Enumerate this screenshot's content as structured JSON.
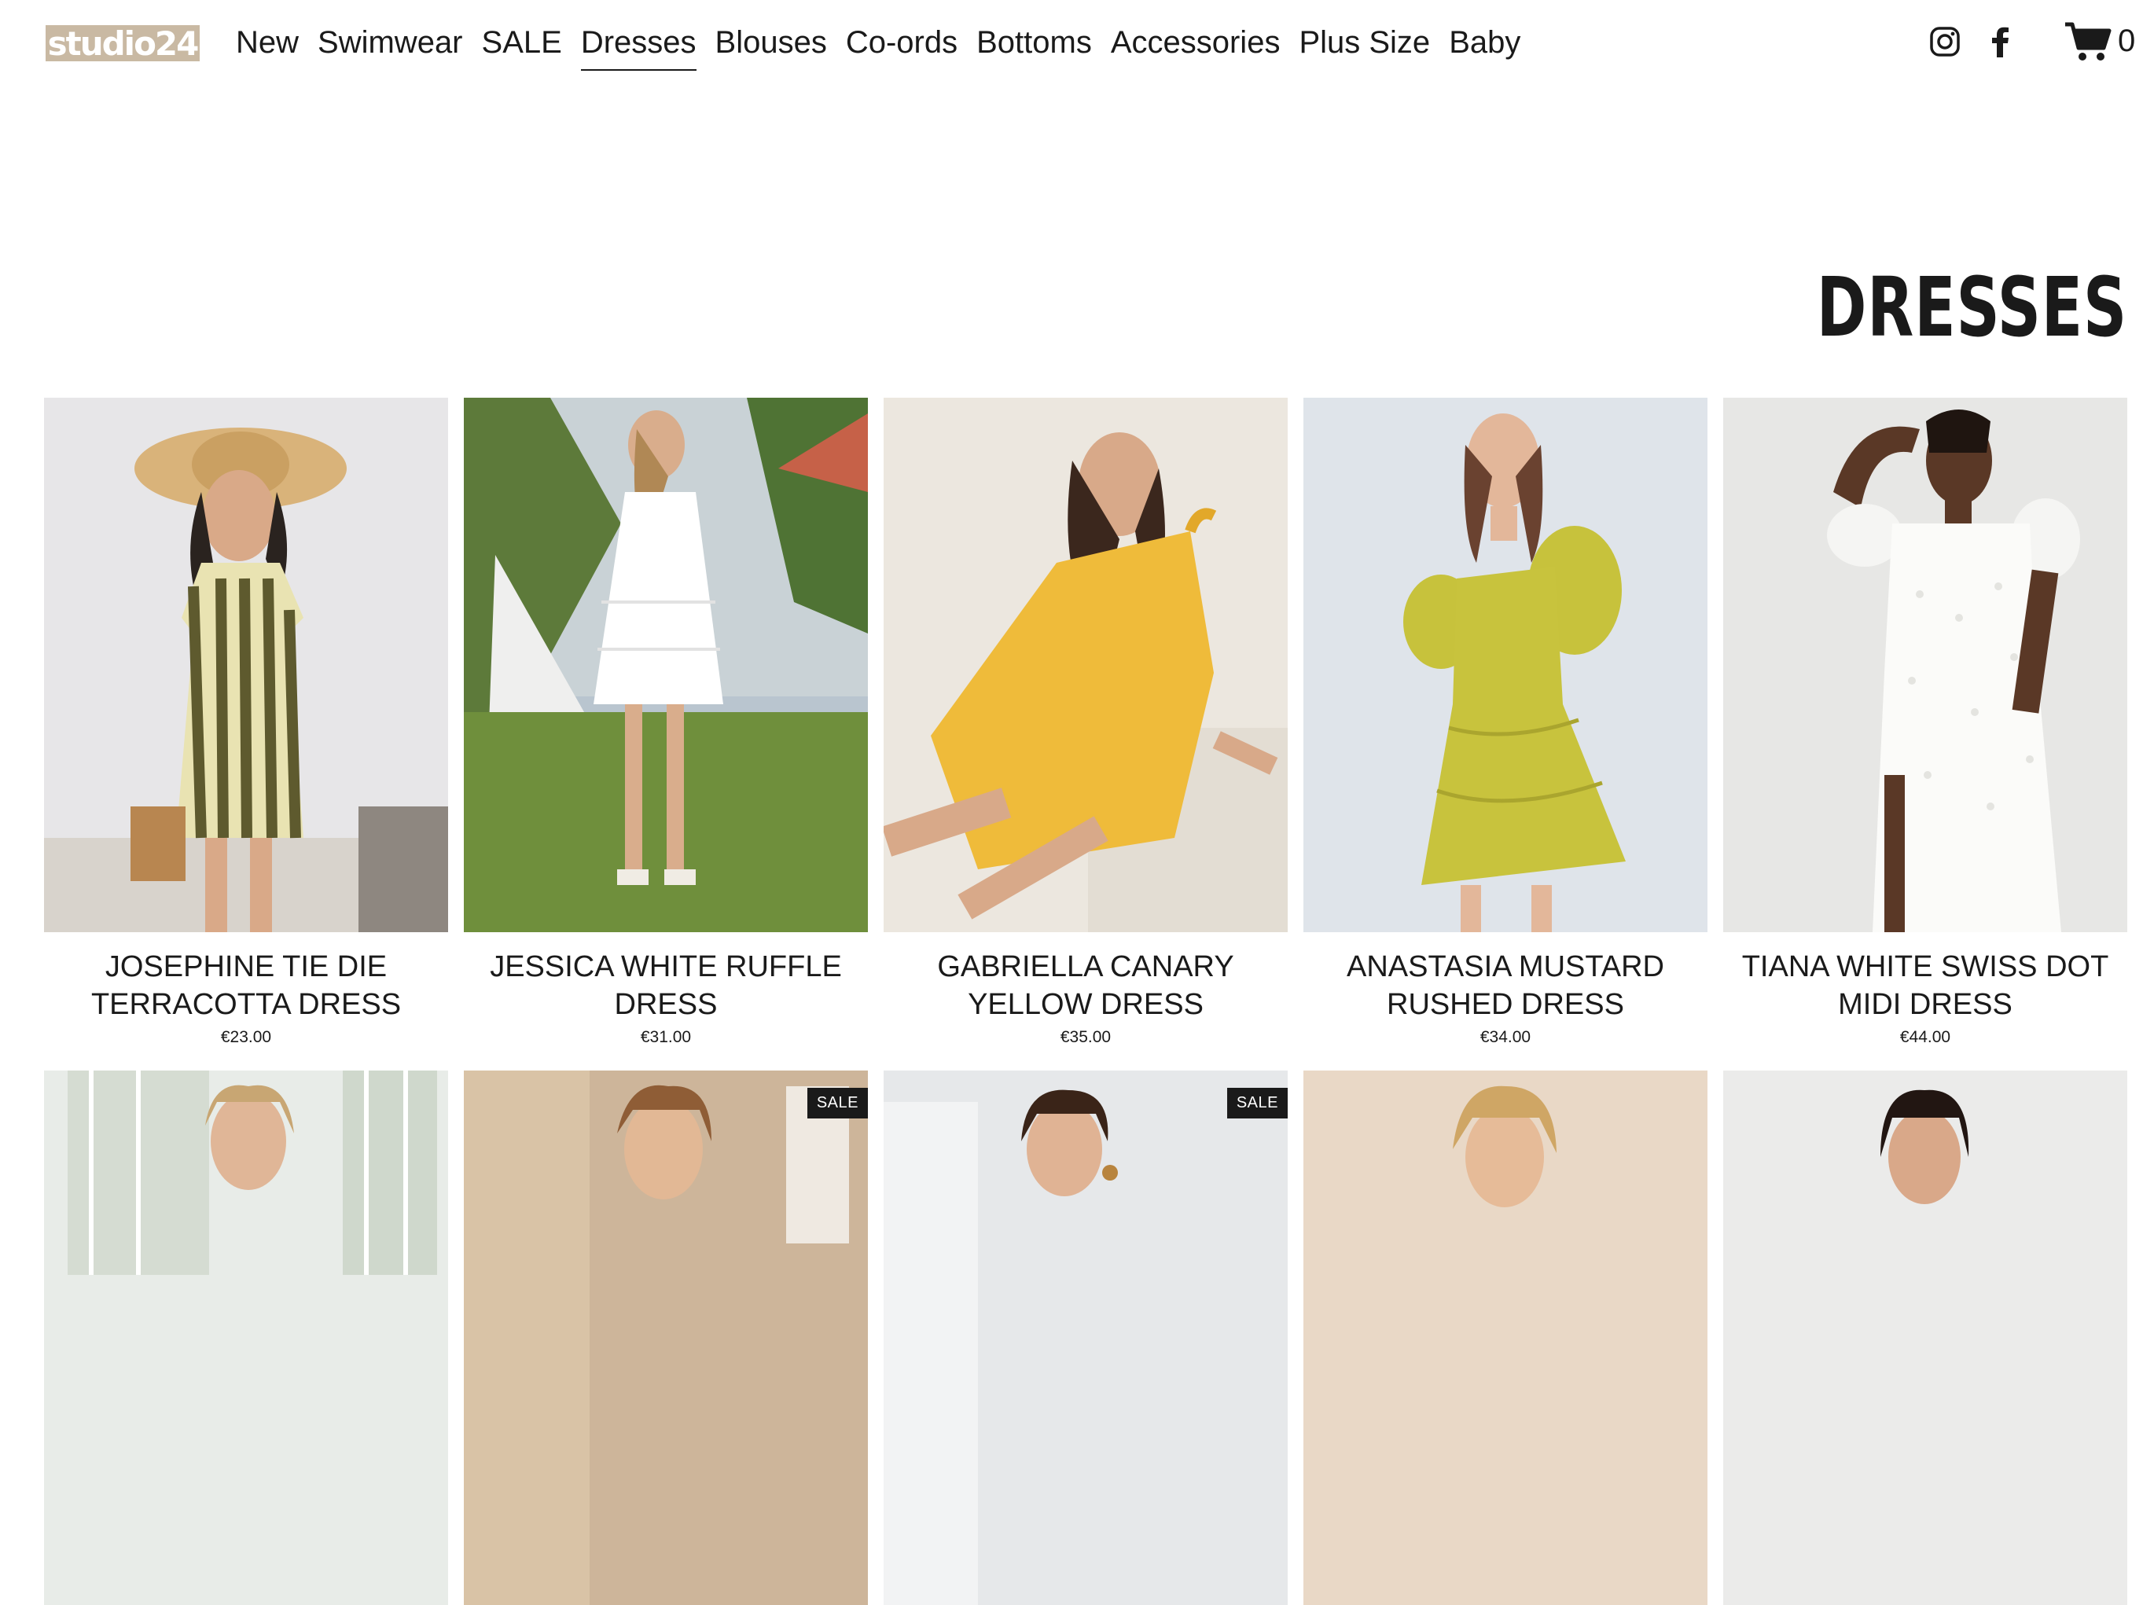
{
  "header": {
    "logo": "studio24",
    "nav": [
      "New",
      "Swimwear",
      "SALE",
      "Dresses",
      "Blouses",
      "Co-ords",
      "Bottoms",
      "Accessories",
      "Plus Size",
      "Baby"
    ],
    "active_nav": "Dresses",
    "cart_count": "0"
  },
  "page": {
    "title": "DRESSES"
  },
  "products": [
    {
      "name": "JOSEPHINE TIE DIE TERRACOTTA DRESS",
      "price": "€23.00"
    },
    {
      "name": "JESSICA WHITE RUFFLE DRESS",
      "price": "€31.00"
    },
    {
      "name": "GABRIELLA CANARY YELLOW DRESS",
      "price": "€35.00"
    },
    {
      "name": "ANASTASIA MUSTARD RUSHED DRESS",
      "price": "€34.00"
    },
    {
      "name": "TIANA WHITE SWISS DOT MIDI DRESS",
      "price": "€44.00"
    }
  ],
  "second_row": [
    {
      "badge": ""
    },
    {
      "badge": "SALE"
    },
    {
      "badge": "SALE"
    },
    {
      "badge": ""
    },
    {
      "badge": ""
    }
  ]
}
